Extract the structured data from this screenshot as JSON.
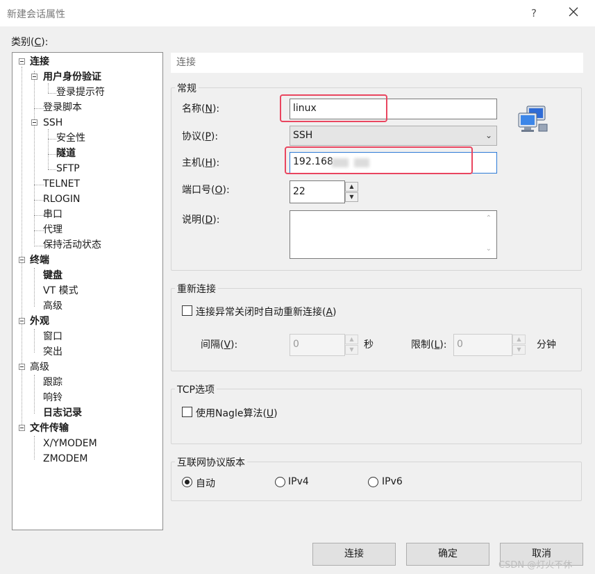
{
  "window": {
    "title": "新建会话属性",
    "help": "?"
  },
  "category": {
    "label": "类别(",
    "key": "C",
    "suffix": "):"
  },
  "tree": {
    "connection": "连接",
    "auth": "用户身份验证",
    "login_prompts": "登录提示符",
    "login_script": "登录脚本",
    "ssh": "SSH",
    "security": "安全性",
    "tunnel": "隧道",
    "sftp": "SFTP",
    "telnet": "TELNET",
    "rlogin": "RLOGIN",
    "serial": "串口",
    "proxy": "代理",
    "keepalive": "保持活动状态",
    "terminal": "终端",
    "keyboard": "键盘",
    "vt_mode": "VT 模式",
    "advanced_term": "高级",
    "appearance": "外观",
    "window": "窗口",
    "highlight": "突出",
    "advanced": "高级",
    "trace": "跟踪",
    "bell": "响铃",
    "logging": "日志记录",
    "file_transfer": "文件传输",
    "xymodem": "X/YMODEM",
    "zmodem": "ZMODEM"
  },
  "panel": {
    "header": "连接"
  },
  "general": {
    "title": "常规",
    "name_label": "名称(",
    "name_key": "N",
    "name_suffix": "):",
    "name_value": "linux",
    "protocol_label": "协议(",
    "protocol_key": "P",
    "protocol_suffix": "):",
    "protocol_value": "SSH",
    "host_label": "主机(",
    "host_key": "H",
    "host_suffix": "):",
    "host_value": "192.168",
    "port_label": "端口号(",
    "port_key": "O",
    "port_suffix": "):",
    "port_value": "22",
    "desc_label": "说明(",
    "desc_key": "D",
    "desc_suffix": "):"
  },
  "reconnect": {
    "title": "重新连接",
    "auto_label": "连接异常关闭时自动重新连接(",
    "auto_key": "A",
    "auto_suffix": ")",
    "interval_label": "间隔(",
    "interval_key": "V",
    "interval_suffix": "):",
    "interval_value": "0",
    "interval_unit": "秒",
    "limit_label": "限制(",
    "limit_key": "L",
    "limit_suffix": "):",
    "limit_value": "0",
    "limit_unit": "分钟"
  },
  "tcp": {
    "title": "TCP选项",
    "nagle_label": "使用Nagle算法(",
    "nagle_key": "U",
    "nagle_suffix": ")"
  },
  "ipver": {
    "title": "互联网协议版本",
    "auto": "自动",
    "ipv4": "IPv4",
    "ipv6": "IPv6"
  },
  "buttons": {
    "connect": "连接",
    "ok": "确定",
    "cancel": "取消"
  },
  "watermark": "CSDN @灯火不休"
}
